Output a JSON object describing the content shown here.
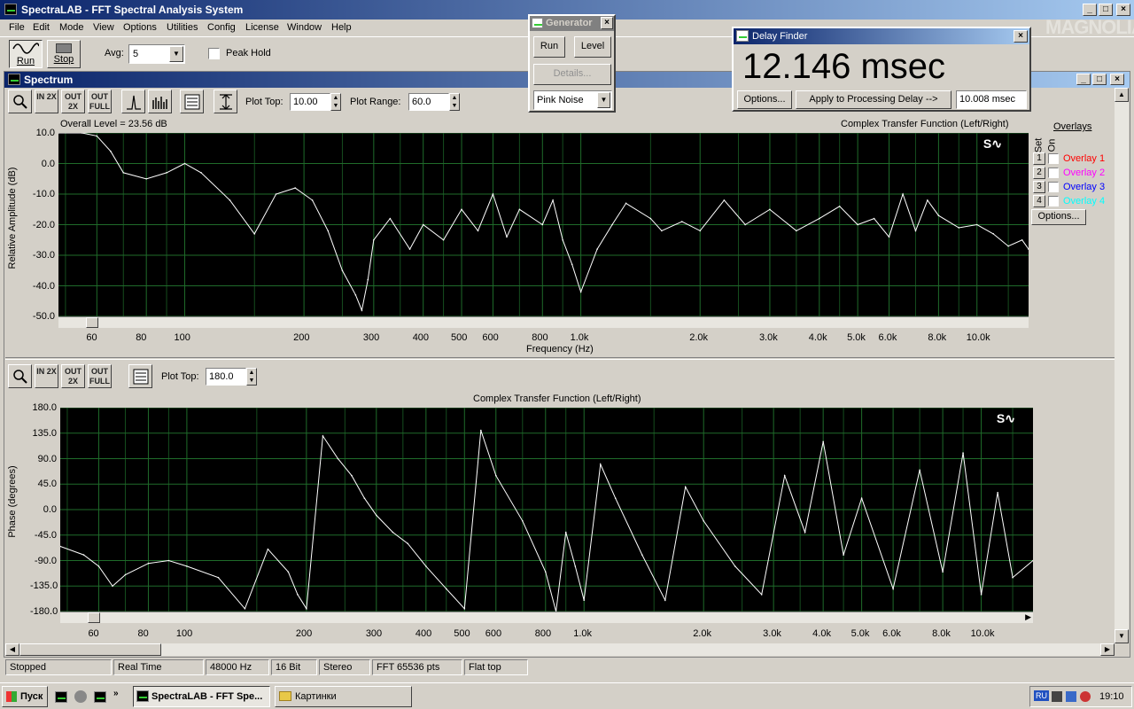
{
  "app": {
    "title": "SpectraLAB - FFT Spectral Analysis System"
  },
  "menu": [
    "File",
    "Edit",
    "Mode",
    "View",
    "Options",
    "Utilities",
    "Config",
    "License",
    "Window",
    "Help"
  ],
  "toolbar": {
    "run": "Run",
    "stop": "Stop",
    "avg_label": "Avg:",
    "avg_value": "5",
    "peak_hold": "Peak Hold"
  },
  "generator": {
    "title": "Generator",
    "run": "Run",
    "level": "Level",
    "details": "Details...",
    "signal": "Pink Noise"
  },
  "delay_finder": {
    "title": "Delay Finder",
    "value": "12.146 msec",
    "options": "Options...",
    "apply": "Apply to Processing Delay -->",
    "delay_field": "10.008 msec"
  },
  "logo": "MAGNOLIA",
  "spectrum": {
    "window_title": "Spectrum",
    "plot_top_label": "Plot Top:",
    "plot_top": "10.00",
    "plot_range_label": "Plot Range:",
    "plot_range": "60.0",
    "phase_plot_top": "180.0",
    "tool_labels": {
      "in": "IN 2X",
      "out": "OUT 2X",
      "full": "OUT FULL"
    }
  },
  "overlays": {
    "title": "Overlays",
    "set": "Set",
    "on": "On",
    "options": "Options...",
    "items": [
      {
        "num": "1",
        "label": "Overlay 1",
        "color": "#ff0000"
      },
      {
        "num": "2",
        "label": "Overlay 2",
        "color": "#ff00ff"
      },
      {
        "num": "3",
        "label": "Overlay 3",
        "color": "#0000ff"
      },
      {
        "num": "4",
        "label": "Overlay 4",
        "color": "#00ffff"
      }
    ]
  },
  "chart_data": [
    {
      "type": "line",
      "title": "Complex Transfer Function (Left/Right)",
      "subtitle": "Overall Level = 23.56 dB",
      "xlabel": "Frequency (Hz)",
      "ylabel": "Relative Amplitude (dB)",
      "xscale": "log",
      "xlim": [
        48,
        13500
      ],
      "ylim": [
        -50,
        10
      ],
      "yticks": [
        "10.0",
        "0.0",
        "-10.0",
        "-20.0",
        "-30.0",
        "-40.0",
        "-50.0"
      ],
      "xticks": [
        "60",
        "80",
        "100",
        "200",
        "300",
        "400",
        "500",
        "600",
        "800",
        "1.0k",
        "2.0k",
        "3.0k",
        "4.0k",
        "5.0k",
        "6.0k",
        "8.0k",
        "10.0k"
      ],
      "xtick_values": [
        60,
        80,
        100,
        200,
        300,
        400,
        500,
        600,
        800,
        1000,
        2000,
        3000,
        4000,
        5000,
        6000,
        8000,
        10000
      ],
      "grid": true,
      "line_color": "#ffffff",
      "series": [
        {
          "x": [
            48,
            55,
            60,
            65,
            70,
            80,
            90,
            100,
            110,
            130,
            150,
            170,
            190,
            210,
            230,
            250,
            270,
            280,
            290,
            300,
            330,
            370,
            400,
            450,
            500,
            550,
            600,
            650,
            700,
            800,
            850,
            900,
            950,
            1000,
            1100,
            1200,
            1300,
            1500,
            1600,
            1800,
            2000,
            2300,
            2600,
            3000,
            3500,
            4000,
            4500,
            5000,
            5500,
            6000,
            6500,
            7000,
            7500,
            8000,
            9000,
            10000,
            11000,
            12000,
            13000,
            13500
          ],
          "y": [
            10,
            10,
            9,
            4,
            -3,
            -5,
            -3,
            0,
            -3,
            -12,
            -23,
            -10,
            -8,
            -12,
            -22,
            -35,
            -43,
            -48,
            -38,
            -25,
            -18,
            -28,
            -20,
            -25,
            -15,
            -22,
            -10,
            -24,
            -15,
            -20,
            -12,
            -25,
            -33,
            -42,
            -28,
            -20,
            -13,
            -18,
            -22,
            -19,
            -22,
            -12,
            -20,
            -15,
            -22,
            -18,
            -14,
            -20,
            -18,
            -24,
            -10,
            -22,
            -12,
            -17,
            -21,
            -20,
            -23,
            -27,
            -25,
            -28
          ]
        }
      ]
    },
    {
      "type": "line",
      "title": "Complex Transfer Function (Left/Right)",
      "xlabel": "",
      "ylabel": "Phase (degrees)",
      "xscale": "log",
      "xlim": [
        48,
        13500
      ],
      "ylim": [
        -180,
        180
      ],
      "yticks": [
        "180.0",
        "135.0",
        "90.0",
        "45.0",
        "0.0",
        "-45.0",
        "-90.0",
        "-135.0",
        "-180.0"
      ],
      "xticks": [
        "60",
        "80",
        "100",
        "200",
        "300",
        "400",
        "500",
        "600",
        "800",
        "1.0k",
        "2.0k",
        "3.0k",
        "4.0k",
        "5.0k",
        "6.0k",
        "8.0k",
        "10.0k"
      ],
      "xtick_values": [
        60,
        80,
        100,
        200,
        300,
        400,
        500,
        600,
        800,
        1000,
        2000,
        3000,
        4000,
        5000,
        6000,
        8000,
        10000
      ],
      "grid": true,
      "line_color": "#ffffff",
      "series": [
        {
          "x": [
            48,
            55,
            60,
            65,
            70,
            80,
            90,
            100,
            120,
            140,
            160,
            180,
            190,
            200,
            220,
            240,
            260,
            280,
            300,
            330,
            360,
            400,
            450,
            500,
            550,
            600,
            700,
            800,
            850,
            900,
            950,
            1000,
            1100,
            1200,
            1400,
            1600,
            1800,
            2000,
            2400,
            2800,
            3200,
            3600,
            4000,
            4500,
            5000,
            6000,
            7000,
            8000,
            9000,
            10000,
            11000,
            12000,
            13500
          ],
          "y": [
            -65,
            -80,
            -100,
            -135,
            -115,
            -95,
            -90,
            -100,
            -120,
            -175,
            -70,
            -110,
            -150,
            -175,
            130,
            90,
            60,
            20,
            -10,
            -40,
            -60,
            -100,
            -140,
            -175,
            140,
            60,
            -20,
            -110,
            -180,
            -40,
            -100,
            -160,
            80,
            20,
            -80,
            -160,
            40,
            -20,
            -100,
            -150,
            60,
            -40,
            120,
            -80,
            20,
            -140,
            70,
            -110,
            100,
            -150,
            30,
            -120,
            -90
          ]
        }
      ]
    }
  ],
  "status": [
    "Stopped",
    "Real Time",
    "48000 Hz",
    "16 Bit",
    "Stereo",
    "FFT 65536 pts",
    "Flat top"
  ],
  "taskbar": {
    "start": "Пуск",
    "task1": "SpectraLAB - FFT Spe...",
    "task2": "Картинки",
    "lang": "RU",
    "clock": "19:10"
  }
}
